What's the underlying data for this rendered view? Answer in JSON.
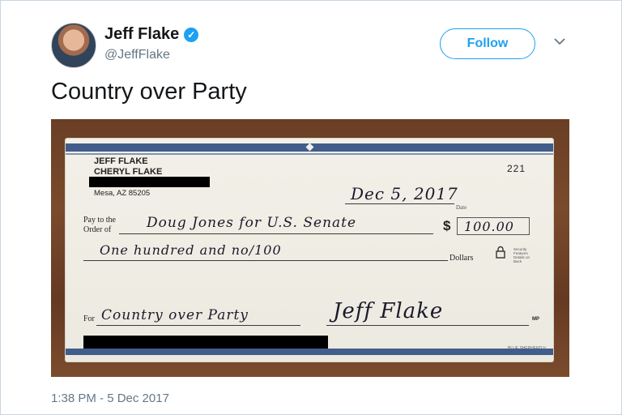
{
  "tweet": {
    "author_name": "Jeff Flake",
    "verified_mark": "✓",
    "handle": "@JeffFlake",
    "follow_label": "Follow",
    "text": "Country over Party",
    "timestamp": "1:38 PM - 5 Dec 2017"
  },
  "check": {
    "name_line1": "JEFF FLAKE",
    "name_line2": "CHERYL FLAKE",
    "city": "Mesa, AZ 85205",
    "number": "221",
    "date_handwritten": "Dec 5, 2017",
    "date_label": "Date",
    "pay_label_1": "Pay to the",
    "pay_label_2": "Order of",
    "payee_handwritten": "Doug Jones for U.S. Senate",
    "dollar_sign": "$",
    "amount_handwritten": "100.00",
    "amount_words_handwritten": "One hundred  and  no/100",
    "dollars_label": "Dollars",
    "security_label": "Security Features Details on Back",
    "for_label": "For",
    "memo_handwritten": "Country over Party",
    "signature_handwritten": "Jeff Flake",
    "mp_label": "MP",
    "printer_label": "BLUE SHEPHERD™"
  },
  "colors": {
    "accent": "#1da1f2",
    "text": "#14171a",
    "secondary_text": "#657786",
    "check_stripe": "#425d8c"
  },
  "icons": [
    "verified-badge-icon",
    "chevron-down-icon",
    "lock-icon"
  ]
}
